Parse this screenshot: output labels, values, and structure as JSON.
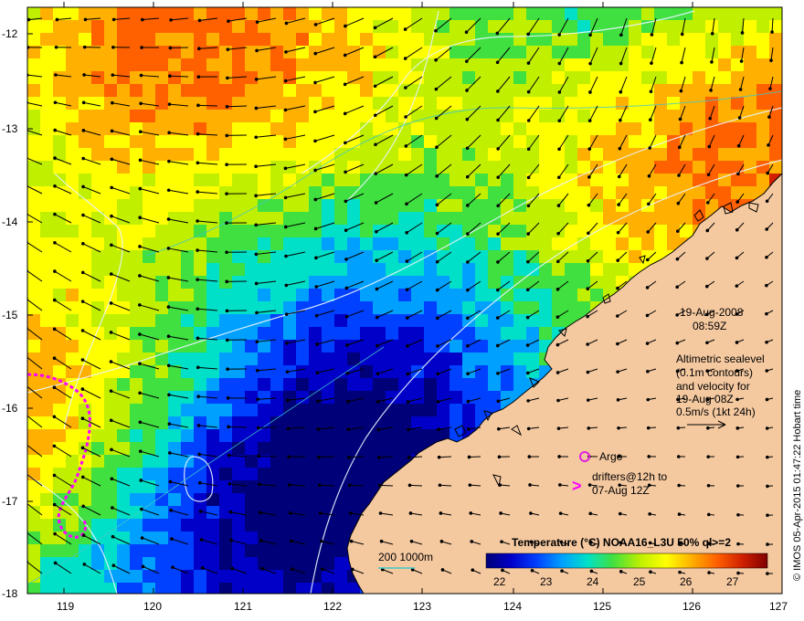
{
  "map": {
    "x_ticks": [
      "119",
      "120",
      "121",
      "122",
      "123",
      "124",
      "125",
      "126",
      "127"
    ],
    "y_ticks": [
      "-12",
      "-13",
      "-14",
      "-15",
      "-16",
      "-17",
      "-18"
    ],
    "date": "19-Aug-2008",
    "time": "08:59Z",
    "legend_lines": [
      "Altimetric sealevel",
      "(0.1m contours)",
      "and velocity for",
      "19-Aug 08Z",
      "0.5m/s (1kt 24h)"
    ],
    "argo_label": "Argo",
    "drifter_lines": [
      "drifters@12h to",
      "07-Aug 12Z"
    ],
    "bathymetry_label": "200  1000m",
    "colorbar": {
      "title": "Temperature (°C) NOAA16_L3U 50% ql>=2",
      "ticks": [
        "22",
        "23",
        "24",
        "25",
        "26",
        "27"
      ]
    },
    "credit": "© IMOS 05-Apr-2015 01:47:22 Hobart time",
    "colors": {
      "land": "#f5c9a0",
      "coastline": "#000000",
      "contour": "#e8f4ff",
      "bathymetry": "#40c8c8",
      "argo": "#e020e0",
      "drifter": "#ff00ff",
      "colormap": [
        "#000078",
        "#0000c8",
        "#0040ff",
        "#00a0ff",
        "#00e0c8",
        "#40e040",
        "#c0f000",
        "#ffff00",
        "#ffb000",
        "#ff6000",
        "#d02000",
        "#800000"
      ]
    }
  }
}
